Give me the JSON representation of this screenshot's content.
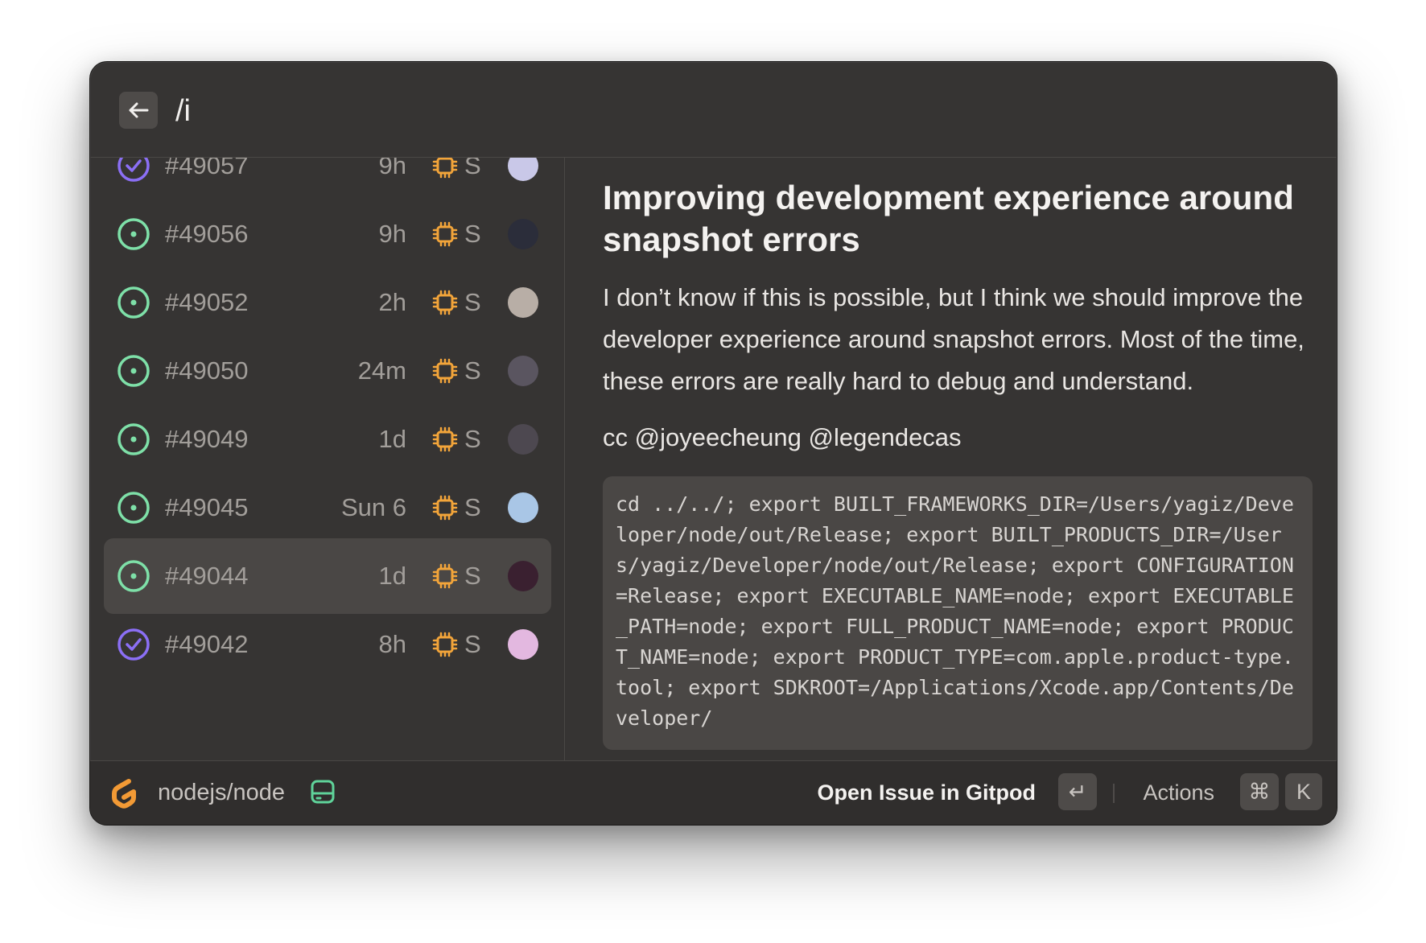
{
  "search": {
    "value": "/i"
  },
  "issues": [
    {
      "number": "#49057",
      "time": "9h",
      "size": "S",
      "status": "closed",
      "avatar_color": "#c9c8e8"
    },
    {
      "number": "#49056",
      "time": "9h",
      "size": "S",
      "status": "open",
      "avatar_color": "#2b2d3a"
    },
    {
      "number": "#49052",
      "time": "2h",
      "size": "S",
      "status": "open",
      "avatar_color": "#b8aea6"
    },
    {
      "number": "#49050",
      "time": "24m",
      "size": "S",
      "status": "open",
      "avatar_color": "#5a5560"
    },
    {
      "number": "#49049",
      "time": "1d",
      "size": "S",
      "status": "open",
      "avatar_color": "#4d4850"
    },
    {
      "number": "#49045",
      "time": "Sun 6",
      "size": "S",
      "status": "open",
      "avatar_color": "#a9c6e6"
    },
    {
      "number": "#49044",
      "time": "1d",
      "size": "S",
      "status": "open",
      "avatar_color": "#3a2030",
      "selected": true
    },
    {
      "number": "#49042",
      "time": "8h",
      "size": "S",
      "status": "closed",
      "avatar_color": "#e3b8e0"
    }
  ],
  "detail": {
    "title": "Improving development experience around snapshot errors",
    "body": "I don’t know if this is possible, but I think we should improve the developer experience around snapshot errors. Most of the time, these errors are really hard to debug and understand.",
    "cc": "cc @joyeecheung @legendecas",
    "code": "cd ../../; export BUILT_FRAMEWORKS_DIR=/Users/yagiz/Developer/node/out/Release; export BUILT_PRODUCTS_DIR=/Users/yagiz/Developer/node/out/Release; export CONFIGURATION=Release; export EXECUTABLE_NAME=node; export EXECUTABLE_PATH=node; export FULL_PRODUCT_NAME=node; export PRODUCT_NAME=node; export PRODUCT_TYPE=com.apple.product-type.tool; export SDKROOT=/Applications/Xcode.app/Contents/Developer/"
  },
  "footer": {
    "repo": "nodejs/node",
    "primary_action": "Open Issue in Gitpod",
    "enter_key": "↵",
    "actions_label": "Actions",
    "cmd_key": "⌘",
    "k_key": "K"
  },
  "colors": {
    "open": "#7ee0a8",
    "closed": "#8b6ff5",
    "chip": "#f3a53a",
    "repo_icon": "#5fd39a",
    "gitpod": "#f29a35"
  },
  "icons": {
    "back": "arrow-left-icon",
    "open": "issue-open-icon",
    "closed": "issue-closed-icon",
    "chip": "cpu-chip-icon",
    "repo": "repo-drive-icon",
    "logo": "gitpod-logo"
  }
}
